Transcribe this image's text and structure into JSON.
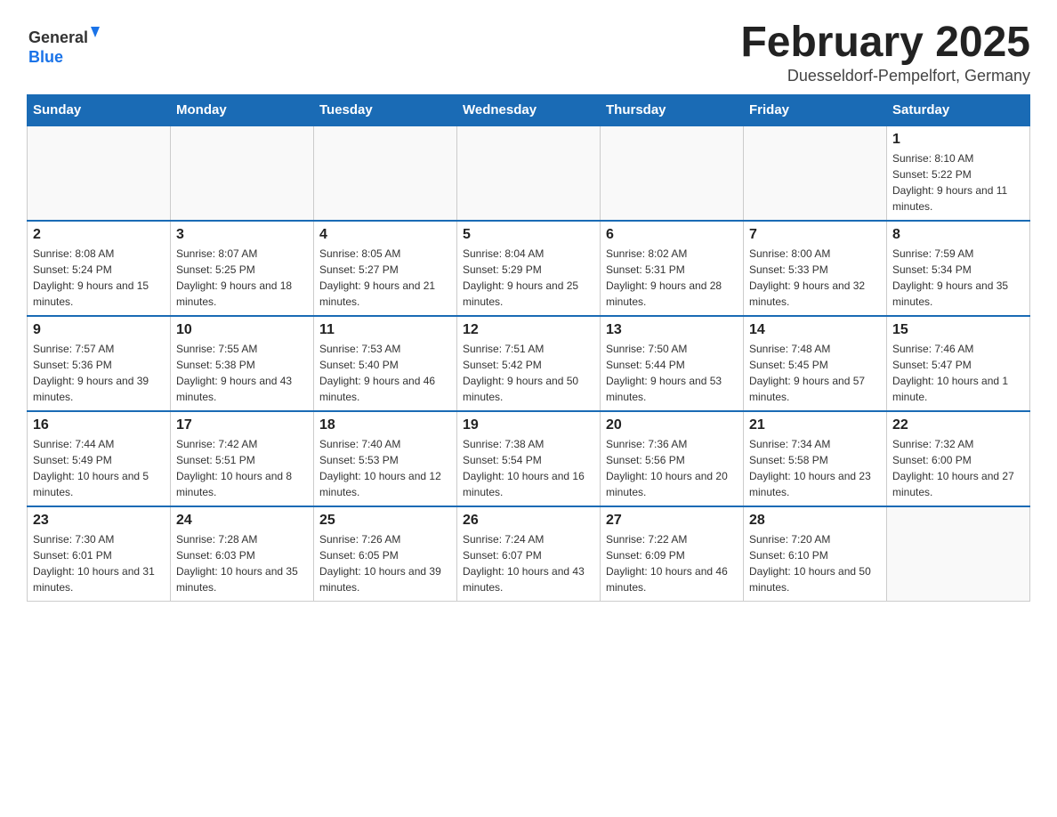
{
  "header": {
    "logo_general": "General",
    "logo_blue": "Blue",
    "month_title": "February 2025",
    "location": "Duesseldorf-Pempelfort, Germany"
  },
  "weekdays": [
    "Sunday",
    "Monday",
    "Tuesday",
    "Wednesday",
    "Thursday",
    "Friday",
    "Saturday"
  ],
  "weeks": [
    [
      {
        "day": "",
        "info": ""
      },
      {
        "day": "",
        "info": ""
      },
      {
        "day": "",
        "info": ""
      },
      {
        "day": "",
        "info": ""
      },
      {
        "day": "",
        "info": ""
      },
      {
        "day": "",
        "info": ""
      },
      {
        "day": "1",
        "info": "Sunrise: 8:10 AM\nSunset: 5:22 PM\nDaylight: 9 hours and 11 minutes."
      }
    ],
    [
      {
        "day": "2",
        "info": "Sunrise: 8:08 AM\nSunset: 5:24 PM\nDaylight: 9 hours and 15 minutes."
      },
      {
        "day": "3",
        "info": "Sunrise: 8:07 AM\nSunset: 5:25 PM\nDaylight: 9 hours and 18 minutes."
      },
      {
        "day": "4",
        "info": "Sunrise: 8:05 AM\nSunset: 5:27 PM\nDaylight: 9 hours and 21 minutes."
      },
      {
        "day": "5",
        "info": "Sunrise: 8:04 AM\nSunset: 5:29 PM\nDaylight: 9 hours and 25 minutes."
      },
      {
        "day": "6",
        "info": "Sunrise: 8:02 AM\nSunset: 5:31 PM\nDaylight: 9 hours and 28 minutes."
      },
      {
        "day": "7",
        "info": "Sunrise: 8:00 AM\nSunset: 5:33 PM\nDaylight: 9 hours and 32 minutes."
      },
      {
        "day": "8",
        "info": "Sunrise: 7:59 AM\nSunset: 5:34 PM\nDaylight: 9 hours and 35 minutes."
      }
    ],
    [
      {
        "day": "9",
        "info": "Sunrise: 7:57 AM\nSunset: 5:36 PM\nDaylight: 9 hours and 39 minutes."
      },
      {
        "day": "10",
        "info": "Sunrise: 7:55 AM\nSunset: 5:38 PM\nDaylight: 9 hours and 43 minutes."
      },
      {
        "day": "11",
        "info": "Sunrise: 7:53 AM\nSunset: 5:40 PM\nDaylight: 9 hours and 46 minutes."
      },
      {
        "day": "12",
        "info": "Sunrise: 7:51 AM\nSunset: 5:42 PM\nDaylight: 9 hours and 50 minutes."
      },
      {
        "day": "13",
        "info": "Sunrise: 7:50 AM\nSunset: 5:44 PM\nDaylight: 9 hours and 53 minutes."
      },
      {
        "day": "14",
        "info": "Sunrise: 7:48 AM\nSunset: 5:45 PM\nDaylight: 9 hours and 57 minutes."
      },
      {
        "day": "15",
        "info": "Sunrise: 7:46 AM\nSunset: 5:47 PM\nDaylight: 10 hours and 1 minute."
      }
    ],
    [
      {
        "day": "16",
        "info": "Sunrise: 7:44 AM\nSunset: 5:49 PM\nDaylight: 10 hours and 5 minutes."
      },
      {
        "day": "17",
        "info": "Sunrise: 7:42 AM\nSunset: 5:51 PM\nDaylight: 10 hours and 8 minutes."
      },
      {
        "day": "18",
        "info": "Sunrise: 7:40 AM\nSunset: 5:53 PM\nDaylight: 10 hours and 12 minutes."
      },
      {
        "day": "19",
        "info": "Sunrise: 7:38 AM\nSunset: 5:54 PM\nDaylight: 10 hours and 16 minutes."
      },
      {
        "day": "20",
        "info": "Sunrise: 7:36 AM\nSunset: 5:56 PM\nDaylight: 10 hours and 20 minutes."
      },
      {
        "day": "21",
        "info": "Sunrise: 7:34 AM\nSunset: 5:58 PM\nDaylight: 10 hours and 23 minutes."
      },
      {
        "day": "22",
        "info": "Sunrise: 7:32 AM\nSunset: 6:00 PM\nDaylight: 10 hours and 27 minutes."
      }
    ],
    [
      {
        "day": "23",
        "info": "Sunrise: 7:30 AM\nSunset: 6:01 PM\nDaylight: 10 hours and 31 minutes."
      },
      {
        "day": "24",
        "info": "Sunrise: 7:28 AM\nSunset: 6:03 PM\nDaylight: 10 hours and 35 minutes."
      },
      {
        "day": "25",
        "info": "Sunrise: 7:26 AM\nSunset: 6:05 PM\nDaylight: 10 hours and 39 minutes."
      },
      {
        "day": "26",
        "info": "Sunrise: 7:24 AM\nSunset: 6:07 PM\nDaylight: 10 hours and 43 minutes."
      },
      {
        "day": "27",
        "info": "Sunrise: 7:22 AM\nSunset: 6:09 PM\nDaylight: 10 hours and 46 minutes."
      },
      {
        "day": "28",
        "info": "Sunrise: 7:20 AM\nSunset: 6:10 PM\nDaylight: 10 hours and 50 minutes."
      },
      {
        "day": "",
        "info": ""
      }
    ]
  ]
}
